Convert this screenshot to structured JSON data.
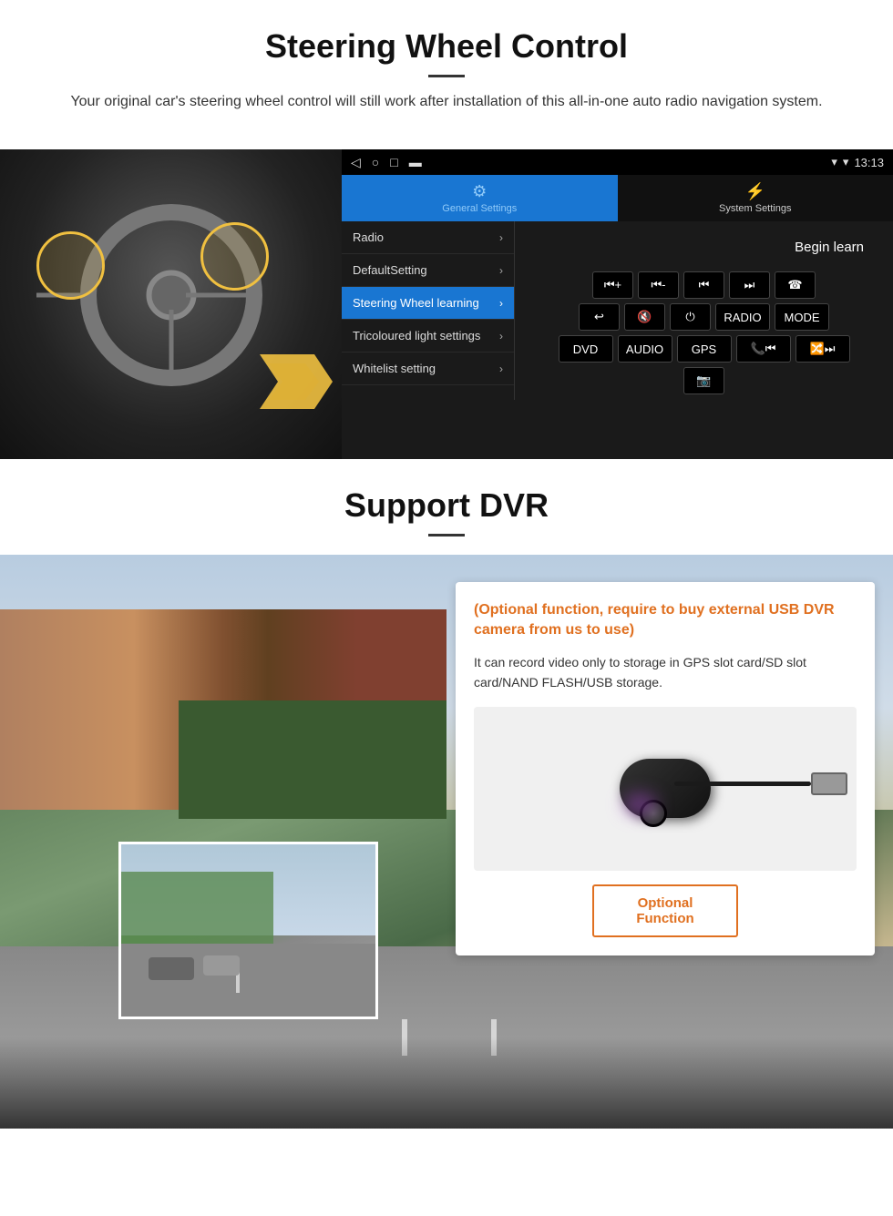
{
  "section1": {
    "title": "Steering Wheel Control",
    "subtitle": "Your original car's steering wheel control will still work after installation of this all-in-one auto radio navigation system.",
    "android": {
      "status_bar": {
        "signal": "▾",
        "time": "13:13"
      },
      "tabs": [
        {
          "label": "General Settings",
          "icon": "⚙",
          "active": true
        },
        {
          "label": "System Settings",
          "icon": "⚡",
          "active": false
        }
      ],
      "menu_items": [
        {
          "label": "Radio",
          "active": false
        },
        {
          "label": "DefaultSetting",
          "active": false
        },
        {
          "label": "Steering Wheel learning",
          "active": true
        },
        {
          "label": "Tricoloured light settings",
          "active": false
        },
        {
          "label": "Whitelist setting",
          "active": false
        }
      ],
      "begin_learn": "Begin learn",
      "control_buttons_row1": [
        "⏮+",
        "⏮-",
        "⏮",
        "⏭",
        "☎"
      ],
      "control_buttons_row2": [
        "↩",
        "🔇",
        "⏻",
        "RADIO",
        "MODE"
      ],
      "control_buttons_row3": [
        "DVD",
        "AUDIO",
        "GPS",
        "📞⏮",
        "🔀⏭"
      ],
      "control_buttons_row4": [
        "📷"
      ]
    }
  },
  "section2": {
    "title": "Support DVR",
    "optional_note": "(Optional function, require to buy external USB DVR camera from us to use)",
    "description": "It can record video only to storage in GPS slot card/SD slot card/NAND FLASH/USB storage.",
    "optional_fn_label": "Optional Function"
  }
}
